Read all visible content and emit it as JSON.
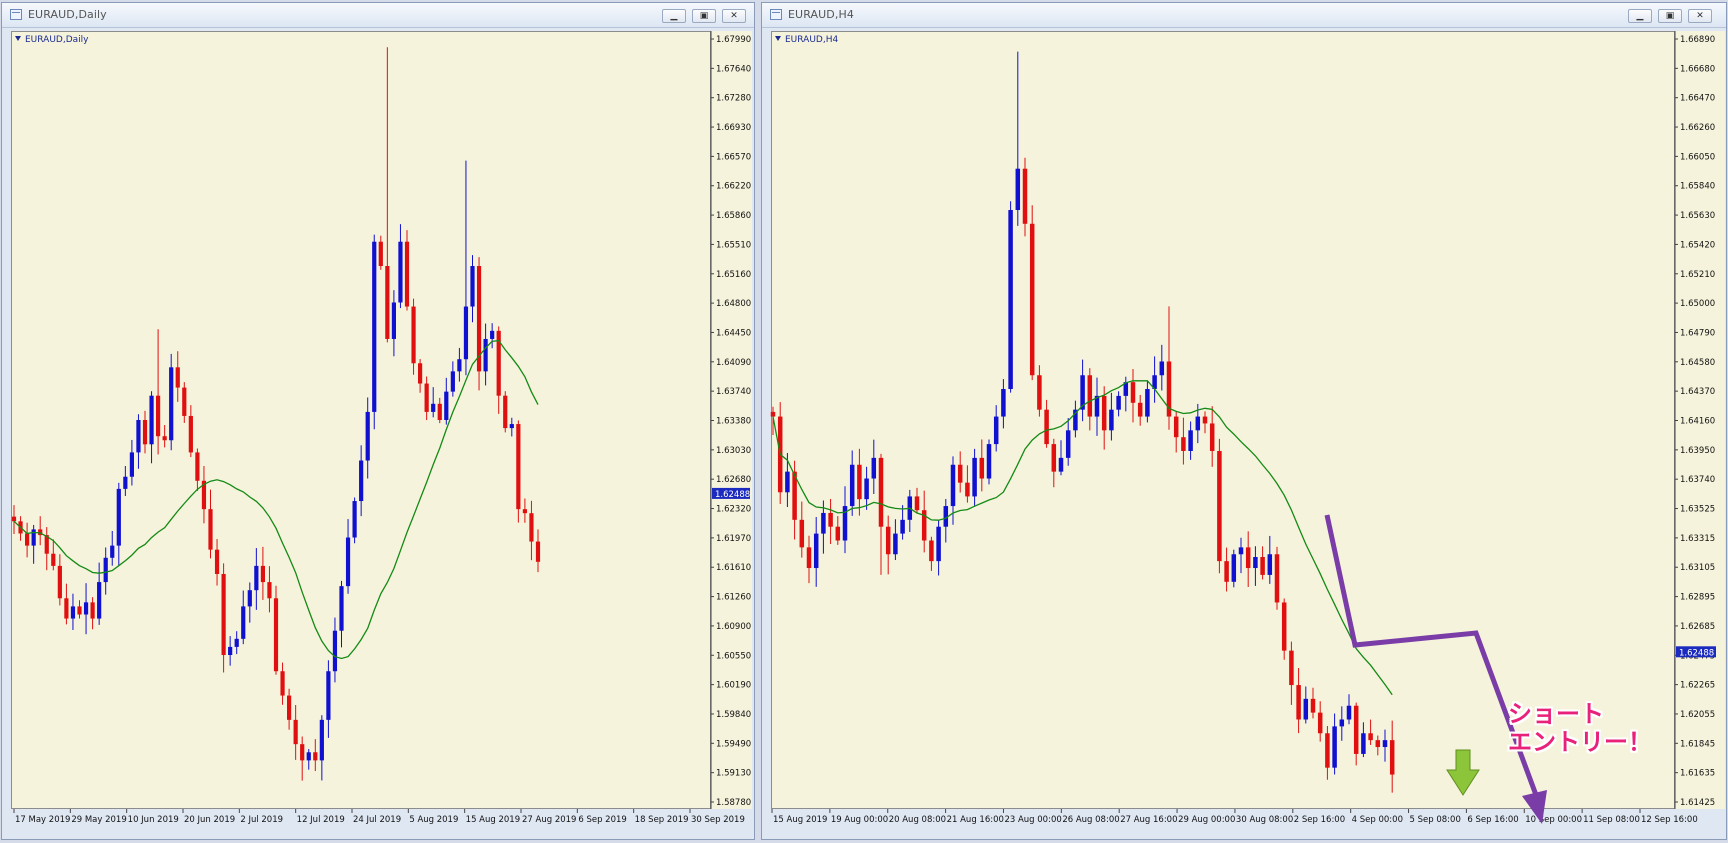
{
  "windows": [
    {
      "title": "EURAUD,Daily",
      "label": "EURAUD,Daily",
      "buttons": [
        "minimize",
        "restore",
        "close"
      ]
    },
    {
      "title": "EURAUD,H4",
      "label": "EURAUD,H4",
      "buttons": [
        "minimize",
        "restore",
        "close"
      ]
    }
  ],
  "annotation": {
    "line1": "ショート",
    "line2": "エントリー！"
  },
  "colors": {
    "bull": "#1010d0",
    "bear": "#e01010",
    "ma": "#158a15",
    "arrow": "#7a3da8",
    "down_arrow": "#8cc43a",
    "price_tag": "#1c2bbf",
    "annotation": "#e8217a"
  },
  "chart_data": [
    {
      "type": "candlestick",
      "symbol": "EURAUD",
      "timeframe": "Daily",
      "ylim": [
        1.586,
        1.682
      ],
      "y_ticks": [
        "1.67990",
        "1.67640",
        "1.67280",
        "1.66930",
        "1.66570",
        "1.66220",
        "1.65860",
        "1.65510",
        "1.65160",
        "1.64800",
        "1.64450",
        "1.64090",
        "1.63740",
        "1.63380",
        "1.63030",
        "1.62680",
        "1.62320",
        "1.61970",
        "1.61610",
        "1.61260",
        "1.60900",
        "1.60550",
        "1.60190",
        "1.59840",
        "1.59490",
        "1.59130",
        "1.58780"
      ],
      "current_price": "1.62488",
      "x_ticks": [
        "17 May 2019",
        "29 May 2019",
        "10 Jun 2019",
        "20 Jun 2019",
        "2 Jul 2019",
        "12 Jul 2019",
        "24 Jul 2019",
        "5 Aug 2019",
        "15 Aug 2019",
        "27 Aug 2019",
        "6 Sep 2019",
        "18 Sep 2019",
        "30 Sep 2019"
      ],
      "closes": [
        1.6215,
        1.62,
        1.6185,
        1.6205,
        1.6198,
        1.6175,
        1.616,
        1.612,
        1.6095,
        1.611,
        1.61,
        1.6115,
        1.6095,
        1.614,
        1.617,
        1.6185,
        1.6255,
        1.627,
        1.63,
        1.634,
        1.631,
        1.637,
        1.632,
        1.6315,
        1.6405,
        1.638,
        1.6345,
        1.63,
        1.6265,
        1.623,
        1.618,
        1.615,
        1.605,
        1.606,
        1.607,
        1.611,
        1.613,
        1.616,
        1.614,
        1.612,
        1.603,
        1.6,
        1.597,
        1.594,
        1.592,
        1.593,
        1.592,
        1.597,
        1.603,
        1.608,
        1.6135,
        1.6195,
        1.624,
        1.629,
        1.635,
        1.656,
        1.653,
        1.644,
        1.6485,
        1.656,
        1.648,
        1.641,
        1.6385,
        1.635,
        1.636,
        1.634,
        1.6375,
        1.64,
        1.6415,
        1.648,
        1.653,
        1.64,
        1.644,
        1.645,
        1.637,
        1.633,
        1.6335,
        1.623,
        1.6225,
        1.619,
        1.6165
      ],
      "ma_period": 20
    },
    {
      "type": "candlestick",
      "symbol": "EURAUD",
      "timeframe": "H4",
      "ylim": [
        1.6135,
        1.67
      ],
      "y_ticks": [
        "1.66890",
        "1.66680",
        "1.66470",
        "1.66260",
        "1.66050",
        "1.65840",
        "1.65630",
        "1.65420",
        "1.65210",
        "1.65000",
        "1.64790",
        "1.64580",
        "1.64370",
        "1.64160",
        "1.63950",
        "1.63740",
        "1.63525",
        "1.63315",
        "1.63105",
        "1.62895",
        "1.62685",
        "1.62475",
        "1.62265",
        "1.62055",
        "1.61845",
        "1.61635",
        "1.61425"
      ],
      "current_price": "1.62488",
      "x_ticks": [
        "15 Aug 2019",
        "19 Aug 00:00",
        "20 Aug 08:00",
        "21 Aug 16:00",
        "23 Aug 00:00",
        "26 Aug 08:00",
        "27 Aug 16:00",
        "29 Aug 00:00",
        "30 Aug 08:00",
        "2 Sep 16:00",
        "4 Sep 00:00",
        "5 Sep 08:00",
        "6 Sep 16:00",
        "10 Sep 00:00",
        "11 Sep 08:00",
        "12 Sep 16:00"
      ],
      "closes": [
        1.642,
        1.6365,
        1.638,
        1.6345,
        1.6325,
        1.631,
        1.6335,
        1.635,
        1.634,
        1.633,
        1.6355,
        1.6385,
        1.636,
        1.6375,
        1.639,
        1.634,
        1.632,
        1.6335,
        1.6345,
        1.6362,
        1.6352,
        1.633,
        1.6315,
        1.634,
        1.6355,
        1.6385,
        1.6372,
        1.6362,
        1.639,
        1.6375,
        1.64,
        1.642,
        1.644,
        1.657,
        1.66,
        1.656,
        1.645,
        1.6425,
        1.64,
        1.638,
        1.639,
        1.641,
        1.6425,
        1.645,
        1.642,
        1.6435,
        1.641,
        1.6425,
        1.6435,
        1.6445,
        1.643,
        1.642,
        1.644,
        1.645,
        1.646,
        1.642,
        1.6405,
        1.6395,
        1.641,
        1.642,
        1.6415,
        1.6395,
        1.6315,
        1.63,
        1.632,
        1.6325,
        1.631,
        1.6318,
        1.6305,
        1.632,
        1.6285,
        1.625,
        1.6225,
        1.62,
        1.6215,
        1.6205,
        1.619,
        1.6165,
        1.6195,
        1.62,
        1.621,
        1.6175,
        1.619,
        1.6185,
        1.618,
        1.6185,
        1.616
      ],
      "ma_period": 20
    }
  ]
}
